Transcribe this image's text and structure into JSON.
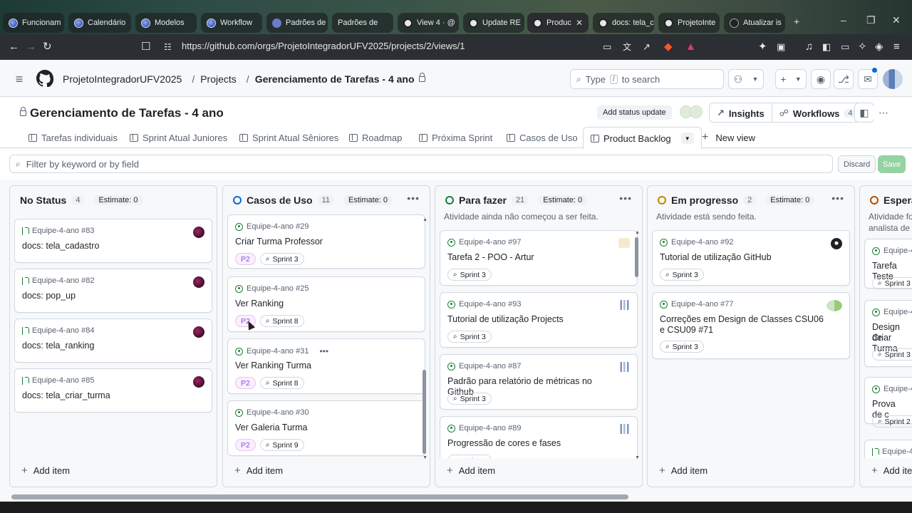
{
  "browser": {
    "tabs": [
      {
        "label": "Funcionam",
        "icon": "purple-circle-icon"
      },
      {
        "label": "Calendário",
        "icon": "purple-circle-icon"
      },
      {
        "label": "Modelos",
        "icon": "purple-circle-icon"
      },
      {
        "label": "Workflow",
        "icon": "purple-circle-icon"
      },
      {
        "label": "Padrões de",
        "icon": "list-icon"
      },
      {
        "label": "Padrões de",
        "icon": "none"
      },
      {
        "label": "View 4 · @",
        "icon": "github-icon"
      },
      {
        "label": "Update RE",
        "icon": "github-icon"
      },
      {
        "label": "Produc",
        "icon": "github-icon",
        "active": true
      },
      {
        "label": "docs: tela_c",
        "icon": "github-icon"
      },
      {
        "label": "ProjetoInte",
        "icon": "github-icon"
      },
      {
        "label": "Atualizar is",
        "icon": "gear-icon"
      }
    ],
    "new_tab": "+",
    "url": "https://github.com/orgs/ProjetoIntegradorUFV2025/projects/2/views/1"
  },
  "header": {
    "org": "ProjetoIntegradorUFV2025",
    "projects": "Projects",
    "current": "Gerenciamento de Tarefas - 4 ano",
    "search_prefix": "Type",
    "search_key": "/",
    "search_suffix": "to search"
  },
  "project": {
    "title": "Gerenciamento de Tarefas - 4 ano",
    "status_update": "Add status update",
    "insights": "Insights",
    "workflows": "Workflows",
    "workflows_count": "4"
  },
  "views": [
    {
      "label": "Tarefas individuais"
    },
    {
      "label": "Sprint Atual Juniores"
    },
    {
      "label": "Sprint Atual Sêniores"
    },
    {
      "label": "Roadmap"
    },
    {
      "label": "Próxima Sprint"
    },
    {
      "label": "Casos de Uso"
    },
    {
      "label": "Product Backlog",
      "active": true
    }
  ],
  "new_view": "New view",
  "filter": {
    "placeholder": "Filter by keyword or by field",
    "discard": "Discard",
    "save": "Save"
  },
  "add_item": "Add item",
  "columns": [
    {
      "title": "No Status",
      "count": "4",
      "estimate": "Estimate: 0",
      "dot": "none",
      "description": "",
      "cards": [
        {
          "meta": "Equipe-4-ano #83",
          "title": "docs: tela_cadastro",
          "type": "pr",
          "tags": [],
          "avatar": "dark"
        },
        {
          "meta": "Equipe-4-ano #82",
          "title": "docs: pop_up",
          "type": "pr",
          "tags": [],
          "avatar": "dark"
        },
        {
          "meta": "Equipe-4-ano #84",
          "title": "docs: tela_ranking",
          "type": "pr",
          "tags": [],
          "avatar": "dark"
        },
        {
          "meta": "Equipe-4-ano #85",
          "title": "docs: tela_criar_turma",
          "type": "pr",
          "tags": [],
          "avatar": "dark"
        }
      ]
    },
    {
      "title": "Casos de Uso",
      "count": "11",
      "estimate": "Estimate: 0",
      "dot": "#0969da",
      "description": "",
      "cards": [
        {
          "meta": "Equipe-4-ano #29",
          "title": "Criar Turma Professor",
          "type": "issue",
          "tags": [
            "P2",
            "Sprint 3"
          ]
        },
        {
          "meta": "Equipe-4-ano #25",
          "title": "Ver Ranking",
          "type": "issue",
          "tags": [
            "P2",
            "Sprint 8"
          ]
        },
        {
          "meta": "Equipe-4-ano #31",
          "title": "Ver Ranking Turma",
          "type": "issue",
          "tags": [
            "P2",
            "Sprint 8"
          ],
          "menu": "•••"
        },
        {
          "meta": "Equipe-4-ano #30",
          "title": "Ver Galeria Turma",
          "type": "issue",
          "tags": [
            "P2",
            "Sprint 9"
          ]
        }
      ]
    },
    {
      "title": "Para fazer",
      "count": "21",
      "estimate": "Estimate: 0",
      "dot": "#1a7f37",
      "description": "Atividade ainda não começou a ser feita.",
      "cards": [
        {
          "meta": "Equipe-4-ano #97",
          "title": "Tarefa 2 - POO - Artur",
          "type": "issue",
          "tags": [
            "Sprint 3"
          ],
          "avatar": "note"
        },
        {
          "meta": "Equipe-4-ano #93",
          "title": "Tutorial de utilização Projects",
          "type": "issue",
          "tags": [
            "Sprint 3"
          ],
          "avatar": "bar"
        },
        {
          "meta": "Equipe-4-ano #87",
          "title": "Padrão para relatório de métricas no Github",
          "type": "issue",
          "tags": [
            "Sprint 3"
          ],
          "avatar": "bar"
        },
        {
          "meta": "Equipe-4-ano #89",
          "title": "Progressão de cores e fases",
          "type": "issue",
          "tags": [
            "Sprint 3"
          ],
          "avatar": "bar"
        }
      ]
    },
    {
      "title": "Em progresso",
      "count": "2",
      "estimate": "Estimate: 0",
      "dot": "#bf8700",
      "description": "Atividade está sendo feita.",
      "cards": [
        {
          "meta": "Equipe-4-ano #92",
          "title": "Tutorial de utilização GitHub",
          "type": "issue",
          "tags": [
            "Sprint 3"
          ],
          "avatar": "photo"
        },
        {
          "meta": "Equipe-4-ano #77",
          "title": "Correções em Design de Classes CSU06 e CSU09 #71",
          "type": "issue",
          "tags": [
            "Sprint 3"
          ],
          "avatar": "multi"
        }
      ]
    },
    {
      "title": "Espera",
      "count": "",
      "estimate": "",
      "dot": "#bc4c00",
      "description": "Atividade fo",
      "description2": "analista de q",
      "cards": [
        {
          "meta": "Equipe-4",
          "title": "Tarefa Teste",
          "type": "issue",
          "tags": [
            "Sprint 3"
          ]
        },
        {
          "meta": "Equipe-4",
          "title": "Design de",
          "title2": "Criar Turma",
          "type": "issue",
          "tags": [
            "Sprint 3"
          ]
        },
        {
          "meta": "Equipe-4",
          "title": "Prova de c",
          "type": "issue",
          "tags": [
            "Sprint 2"
          ]
        },
        {
          "meta": "Equipe-4",
          "title": "",
          "type": "pr",
          "tags": []
        }
      ],
      "add_item": "Add ite"
    }
  ],
  "colors": {
    "accent": "#0969da",
    "border": "#d1d9e0",
    "canvas": "#f6f8fa",
    "prio": "#8250df",
    "open": "#1a7f37",
    "save": "#94d3a2"
  }
}
